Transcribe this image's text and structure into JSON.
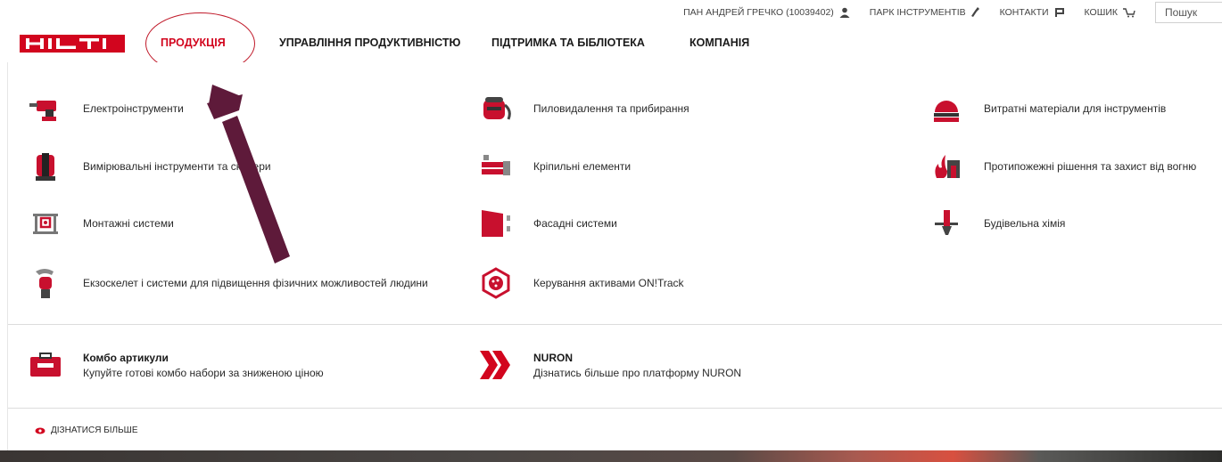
{
  "utility": {
    "user": "ПАН АНДРЕЙ ГРЕЧКО (10039402)",
    "fleet": "ПАРК ІНСТРУМЕНТІВ",
    "contacts": "КОНТАКТИ",
    "cart": "КОШИК",
    "search_placeholder": "Пошук"
  },
  "nav": {
    "logo": "HILTI",
    "items": [
      {
        "label": "ПРОДУКЦІЯ"
      },
      {
        "label": "УПРАВЛІННЯ ПРОДУКТИВНІСТЮ"
      },
      {
        "label": "ПІДТРИМКА ТА БІБЛІОТЕКА"
      },
      {
        "label": "КОМПАНІЯ"
      }
    ]
  },
  "categories": [
    {
      "label": "Електроінструменти",
      "icon": "power-tool-icon"
    },
    {
      "label": "Пиловидалення та прибирання",
      "icon": "vacuum-icon"
    },
    {
      "label": "Витратні матеріали для інструментів",
      "icon": "saw-blade-icon"
    },
    {
      "label": "Вимірювальні інструменти та сканери",
      "icon": "laser-level-icon"
    },
    {
      "label": "Кріпильні елементи",
      "icon": "anchor-icon"
    },
    {
      "label": "Протипожежні рішення та захист від вогню",
      "icon": "firestop-icon"
    },
    {
      "label": "Монтажні системи",
      "icon": "installation-system-icon"
    },
    {
      "label": "Фасадні системи",
      "icon": "facade-icon"
    },
    {
      "label": "Будівельна хімія",
      "icon": "chemical-anchor-icon"
    },
    {
      "label": "Екзоскелет і системи для підвищення фізичних можливостей людини",
      "icon": "exoskeleton-icon"
    },
    {
      "label": "Керування активами ON!Track",
      "icon": "ontrack-icon"
    }
  ],
  "promos": [
    {
      "title": "Комбо артикули",
      "subtitle": "Купуйте готові комбо набори за зниженою ціною",
      "icon": "toolbox-icon"
    },
    {
      "title": "NURON",
      "subtitle": "Дізнатись більше про платформу NURON",
      "icon": "nuron-chevron-icon"
    }
  ],
  "learn_more": "ДІЗНАТИСЯ БІЛЬШЕ",
  "colors": {
    "brand": "#d2051e",
    "annotation": "#5e1a3a"
  }
}
